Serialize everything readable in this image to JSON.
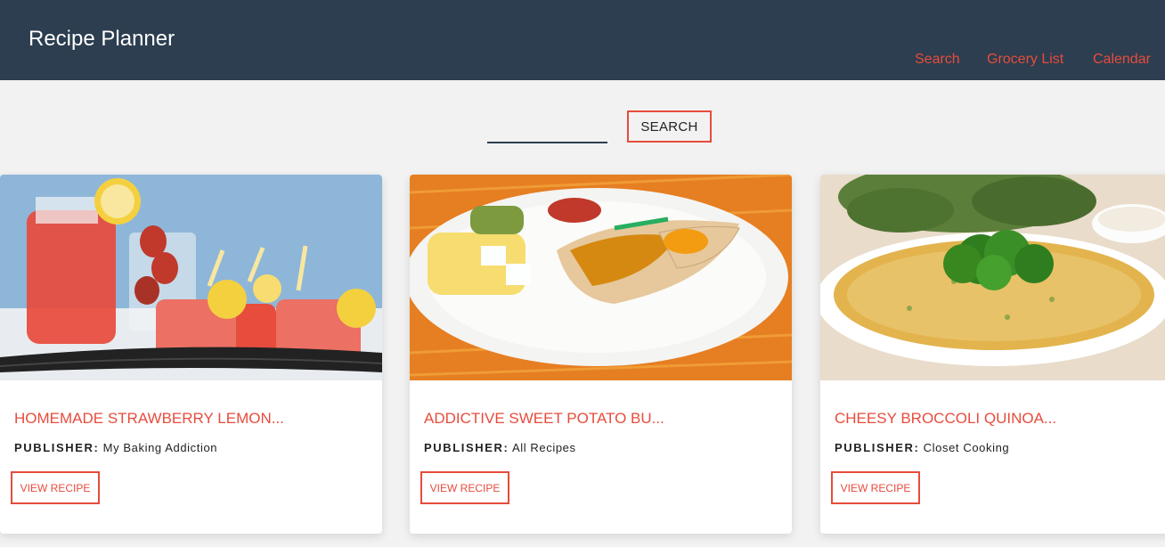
{
  "header": {
    "title": "Recipe Planner",
    "nav": [
      "Search",
      "Grocery List",
      "Calendar"
    ]
  },
  "search": {
    "value": "",
    "button_label": "SEARCH"
  },
  "recipes": [
    {
      "title": "HOMEMADE STRAWBERRY LEMON...",
      "publisher_label": "PUBLISHER:",
      "publisher": "My Baking Addiction",
      "button_label": "VIEW RECIPE",
      "image": "strawberry-lemonade-photo"
    },
    {
      "title": "ADDICTIVE SWEET POTATO BU...",
      "publisher_label": "PUBLISHER:",
      "publisher": "All Recipes",
      "button_label": "VIEW RECIPE",
      "image": "sweet-potato-burrito-photo"
    },
    {
      "title": "CHEESY BROCCOLI QUINOA...",
      "publisher_label": "PUBLISHER:",
      "publisher": "Closet Cooking",
      "button_label": "VIEW RECIPE",
      "image": "broccoli-quinoa-photo"
    }
  ],
  "colors": {
    "header_bg": "#2c3e50",
    "accent": "#e74c3c",
    "page_bg": "#f2f2f2"
  }
}
